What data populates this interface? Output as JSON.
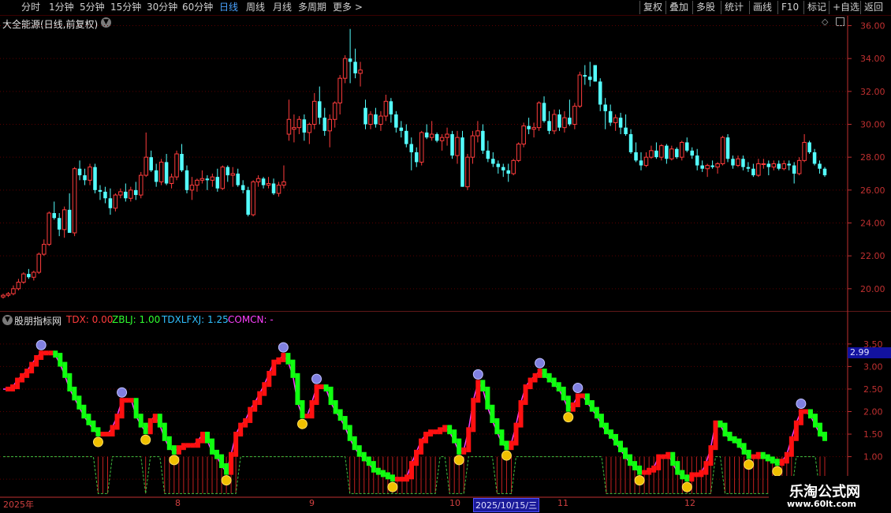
{
  "toolbar": {
    "left_items": [
      "分时",
      "1分钟",
      "5分钟",
      "15分钟",
      "30分钟",
      "60分钟",
      "日线",
      "周线",
      "月线",
      "多周期",
      "更多 >"
    ],
    "active_item": "日线",
    "right_items": [
      "复权",
      "叠加",
      "多股",
      "统计",
      "画线",
      "F10",
      "标记",
      "+自选",
      "返回"
    ]
  },
  "stock": {
    "title": "大全能源(日线,前复权)"
  },
  "price_axis": {
    "labels": [
      "36.00",
      "34.00",
      "32.00",
      "30.00",
      "28.00",
      "26.00",
      "24.00",
      "22.00",
      "20.00"
    ],
    "ymin": 18.6,
    "ymax": 36.6
  },
  "indicator": {
    "name": "股朋指标网",
    "tdx": "TDX: 0.00",
    "zblj": "ZBLJ: 1.00",
    "tdxlfxj": "TDXLFXJ: 1.25",
    "comcn": "COMCN: -",
    "axis_labels": [
      "3.50",
      "3.00",
      "2.50",
      "2.00",
      "1.50",
      "1.00",
      "0.50"
    ],
    "current_value": "2.99",
    "ymin": 0.1,
    "ymax": 3.9
  },
  "dates": {
    "labels": [
      "2025年",
      "8",
      "9",
      "10",
      "2025/10/15/三",
      "11",
      "12"
    ],
    "highlight": "2025/10/15/三"
  },
  "watermark": {
    "line1": "乐淘公式网",
    "line2": "www.60lt.com"
  },
  "colors": {
    "up": "#ff3c3c",
    "down": "#54ffff",
    "grid": "#5a0000",
    "axis": "#c03030",
    "ind_up": "#ff1010",
    "ind_down": "#10ff10",
    "ind_line": "#ff40ff",
    "ind_dash": "#40c040"
  },
  "chart_data": {
    "type": "candlestick",
    "candles": [
      [
        19.5,
        19.7,
        19.4,
        19.6
      ],
      [
        19.6,
        19.8,
        19.5,
        19.7
      ],
      [
        19.7,
        20.2,
        19.6,
        20.0
      ],
      [
        20.0,
        20.6,
        19.9,
        20.4
      ],
      [
        20.4,
        21.0,
        20.3,
        20.9
      ],
      [
        20.9,
        21.2,
        20.6,
        20.7
      ],
      [
        20.7,
        21.1,
        20.5,
        21.0
      ],
      [
        21.0,
        22.2,
        20.9,
        22.1
      ],
      [
        22.1,
        23.0,
        22.0,
        22.7
      ],
      [
        22.7,
        24.7,
        22.6,
        24.6
      ],
      [
        24.6,
        25.3,
        24.2,
        24.3
      ],
      [
        24.3,
        24.6,
        23.2,
        23.6
      ],
      [
        23.6,
        25.0,
        23.1,
        24.8
      ],
      [
        24.8,
        25.8,
        23.4,
        23.4
      ],
      [
        23.4,
        27.4,
        23.2,
        27.3
      ],
      [
        27.3,
        27.8,
        26.6,
        26.9
      ],
      [
        26.9,
        27.3,
        26.3,
        26.6
      ],
      [
        26.6,
        27.6,
        26.3,
        27.4
      ],
      [
        27.4,
        27.6,
        25.8,
        26.0
      ],
      [
        26.0,
        26.3,
        25.4,
        25.9
      ],
      [
        25.9,
        26.2,
        25.2,
        25.5
      ],
      [
        25.5,
        26.1,
        24.5,
        24.9
      ],
      [
        24.9,
        25.8,
        24.7,
        25.7
      ],
      [
        25.7,
        26.1,
        25.5,
        25.9
      ],
      [
        25.9,
        26.4,
        25.3,
        25.5
      ],
      [
        25.5,
        26.2,
        25.3,
        26.0
      ],
      [
        26.0,
        26.5,
        25.4,
        25.7
      ],
      [
        25.7,
        27.1,
        25.5,
        26.9
      ],
      [
        26.9,
        29.5,
        26.8,
        28.0
      ],
      [
        28.0,
        28.4,
        27.1,
        27.2
      ],
      [
        27.2,
        27.6,
        26.2,
        26.5
      ],
      [
        26.5,
        27.9,
        26.3,
        27.7
      ],
      [
        27.7,
        28.2,
        26.3,
        26.4
      ],
      [
        26.4,
        27.0,
        26.1,
        26.8
      ],
      [
        26.8,
        28.4,
        26.6,
        28.2
      ],
      [
        28.2,
        28.8,
        27.1,
        27.2
      ],
      [
        27.2,
        27.5,
        25.8,
        26.0
      ],
      [
        26.0,
        26.8,
        25.4,
        26.3
      ],
      [
        26.3,
        26.7,
        25.9,
        26.6
      ],
      [
        26.6,
        27.2,
        26.4,
        26.7
      ],
      [
        26.7,
        26.9,
        26.0,
        26.6
      ],
      [
        26.6,
        27.0,
        26.2,
        26.8
      ],
      [
        26.8,
        27.3,
        25.9,
        26.1
      ],
      [
        26.1,
        27.5,
        26.0,
        27.4
      ],
      [
        27.4,
        27.5,
        26.5,
        26.9
      ],
      [
        26.9,
        27.4,
        26.2,
        27.0
      ],
      [
        27.0,
        27.3,
        26.2,
        26.3
      ],
      [
        26.3,
        26.6,
        25.8,
        26.0
      ],
      [
        26.0,
        26.2,
        24.4,
        24.5
      ],
      [
        24.5,
        26.6,
        24.4,
        26.5
      ],
      [
        26.5,
        26.9,
        26.2,
        26.7
      ],
      [
        26.7,
        26.8,
        26.1,
        26.3
      ],
      [
        26.3,
        26.8,
        26.1,
        26.4
      ],
      [
        26.4,
        26.7,
        25.7,
        25.8
      ],
      [
        25.8,
        26.5,
        25.6,
        26.3
      ],
      [
        26.3,
        27.5,
        26.1,
        26.5
      ],
      [
        29.4,
        31.5,
        29.0,
        30.3
      ],
      [
        29.7,
        30.6,
        28.9,
        29.8
      ],
      [
        29.8,
        30.5,
        29.4,
        30.3
      ],
      [
        30.3,
        30.6,
        29.0,
        29.5
      ],
      [
        29.5,
        30.1,
        28.8,
        30.0
      ],
      [
        30.0,
        31.9,
        29.7,
        31.4
      ],
      [
        31.4,
        32.3,
        30.0,
        30.4
      ],
      [
        30.4,
        31.0,
        29.3,
        29.6
      ],
      [
        29.6,
        30.6,
        28.6,
        30.3
      ],
      [
        30.3,
        31.4,
        29.8,
        31.3
      ],
      [
        31.3,
        33.0,
        30.6,
        32.8
      ],
      [
        32.8,
        34.2,
        32.5,
        34.0
      ],
      [
        34.0,
        35.8,
        32.5,
        33.8
      ],
      [
        33.8,
        34.6,
        32.8,
        33.1
      ],
      [
        33.1,
        33.8,
        32.3,
        33.3
      ],
      [
        31.0,
        31.5,
        29.7,
        30.0
      ],
      [
        30.0,
        30.8,
        29.7,
        30.6
      ],
      [
        30.6,
        31.0,
        29.8,
        30.0
      ],
      [
        30.0,
        30.8,
        29.6,
        30.5
      ],
      [
        30.5,
        31.8,
        30.2,
        31.4
      ],
      [
        31.4,
        31.6,
        30.1,
        30.6
      ],
      [
        30.6,
        30.8,
        29.5,
        29.8
      ],
      [
        29.8,
        30.2,
        29.2,
        29.6
      ],
      [
        29.6,
        30.0,
        28.6,
        28.8
      ],
      [
        28.8,
        29.2,
        27.2,
        28.3
      ],
      [
        28.3,
        28.6,
        27.4,
        27.7
      ],
      [
        27.7,
        29.6,
        27.5,
        29.5
      ],
      [
        29.5,
        30.0,
        29.1,
        29.2
      ],
      [
        29.2,
        30.2,
        29.0,
        29.4
      ],
      [
        29.4,
        29.5,
        28.9,
        29.0
      ],
      [
        29.0,
        29.4,
        28.4,
        29.2
      ],
      [
        29.2,
        29.8,
        28.7,
        29.4
      ],
      [
        29.4,
        29.6,
        27.9,
        28.1
      ],
      [
        28.1,
        29.6,
        27.6,
        29.2
      ],
      [
        29.2,
        29.6,
        26.2,
        26.2
      ],
      [
        26.2,
        28.2,
        26.0,
        28.0
      ],
      [
        28.0,
        29.6,
        27.6,
        29.3
      ],
      [
        29.3,
        30.2,
        28.9,
        29.6
      ],
      [
        29.6,
        30.0,
        28.2,
        28.4
      ],
      [
        28.4,
        29.0,
        27.7,
        27.9
      ],
      [
        27.9,
        28.3,
        27.4,
        27.6
      ],
      [
        27.6,
        27.8,
        27.0,
        27.4
      ],
      [
        27.4,
        27.6,
        26.8,
        27.2
      ],
      [
        27.2,
        27.6,
        26.5,
        27.0
      ],
      [
        27.0,
        27.9,
        26.9,
        27.8
      ],
      [
        27.8,
        28.9,
        27.7,
        28.8
      ],
      [
        28.8,
        30.1,
        28.6,
        29.9
      ],
      [
        29.9,
        30.4,
        29.4,
        29.7
      ],
      [
        29.7,
        30.1,
        29.2,
        29.8
      ],
      [
        29.8,
        31.4,
        29.6,
        31.3
      ],
      [
        31.3,
        31.7,
        30.1,
        30.2
      ],
      [
        30.2,
        30.8,
        29.4,
        29.6
      ],
      [
        29.6,
        30.9,
        29.4,
        30.6
      ],
      [
        30.6,
        30.9,
        29.6,
        29.8
      ],
      [
        29.8,
        30.8,
        29.5,
        30.4
      ],
      [
        30.4,
        31.5,
        29.9,
        30.0
      ],
      [
        30.0,
        31.3,
        29.7,
        31.1
      ],
      [
        31.1,
        33.2,
        31.0,
        33.0
      ],
      [
        33.0,
        33.6,
        32.4,
        32.9
      ],
      [
        32.9,
        33.8,
        32.3,
        32.7
      ],
      [
        33.6,
        33.6,
        32.6,
        32.6
      ],
      [
        32.6,
        32.8,
        30.8,
        31.2
      ],
      [
        31.2,
        31.6,
        29.7,
        30.8
      ],
      [
        30.8,
        31.2,
        29.9,
        30.1
      ],
      [
        30.1,
        30.6,
        29.6,
        30.4
      ],
      [
        30.4,
        30.7,
        29.4,
        29.8
      ],
      [
        29.8,
        30.6,
        29.3,
        29.4
      ],
      [
        29.4,
        29.7,
        28.2,
        28.3
      ],
      [
        28.3,
        28.9,
        27.7,
        27.8
      ],
      [
        27.8,
        28.3,
        27.2,
        27.5
      ],
      [
        27.5,
        28.3,
        27.4,
        28.0
      ],
      [
        28.0,
        28.7,
        27.9,
        28.4
      ],
      [
        28.4,
        28.9,
        27.9,
        28.0
      ],
      [
        28.0,
        28.8,
        27.8,
        28.7
      ],
      [
        28.7,
        28.8,
        27.6,
        27.9
      ],
      [
        27.9,
        28.7,
        27.8,
        28.5
      ],
      [
        28.5,
        28.6,
        27.9,
        28.0
      ],
      [
        28.0,
        29.0,
        27.8,
        28.9
      ],
      [
        28.9,
        29.2,
        28.3,
        28.4
      ],
      [
        28.4,
        28.6,
        27.9,
        28.1
      ],
      [
        28.1,
        28.5,
        27.2,
        27.5
      ],
      [
        27.5,
        27.8,
        27.1,
        27.3
      ],
      [
        27.3,
        27.6,
        26.8,
        27.5
      ],
      [
        27.5,
        27.8,
        27.3,
        27.4
      ],
      [
        27.4,
        27.7,
        27.0,
        27.6
      ],
      [
        27.6,
        29.3,
        27.5,
        29.2
      ],
      [
        29.2,
        29.4,
        27.7,
        27.9
      ],
      [
        27.9,
        28.1,
        27.3,
        27.5
      ],
      [
        27.5,
        28.1,
        27.4,
        27.9
      ],
      [
        27.9,
        28.1,
        27.2,
        27.4
      ],
      [
        27.4,
        27.7,
        27.1,
        27.3
      ],
      [
        27.3,
        27.6,
        26.8,
        26.9
      ],
      [
        26.9,
        27.9,
        26.8,
        27.6
      ],
      [
        27.6,
        27.9,
        27.3,
        27.6
      ],
      [
        27.6,
        27.8,
        26.9,
        27.4
      ],
      [
        27.4,
        27.8,
        27.2,
        27.6
      ],
      [
        27.6,
        27.8,
        27.2,
        27.3
      ],
      [
        27.3,
        27.8,
        27.2,
        27.6
      ],
      [
        27.6,
        27.8,
        27.2,
        27.5
      ],
      [
        27.5,
        27.7,
        26.4,
        27.0
      ],
      [
        27.0,
        28.0,
        26.9,
        27.8
      ],
      [
        27.8,
        29.4,
        27.7,
        28.9
      ],
      [
        28.9,
        29.0,
        28.2,
        28.3
      ],
      [
        28.3,
        28.5,
        27.5,
        27.6
      ],
      [
        27.6,
        27.8,
        27.0,
        27.3
      ],
      [
        27.3,
        27.4,
        26.8,
        26.9
      ]
    ],
    "indicator_series": [
      2.5,
      2.5,
      2.55,
      2.7,
      2.8,
      2.9,
      3.05,
      3.2,
      3.3,
      3.3,
      3.3,
      3.25,
      3.05,
      2.8,
      2.5,
      2.3,
      2.1,
      1.9,
      1.75,
      1.6,
      1.5,
      1.5,
      1.5,
      1.65,
      1.9,
      2.25,
      2.25,
      2.25,
      1.9,
      1.7,
      1.55,
      1.8,
      1.9,
      1.7,
      1.4,
      1.2,
      1.1,
      1.2,
      1.25,
      1.25,
      1.25,
      1.35,
      1.5,
      1.35,
      1.1,
      1.0,
      0.8,
      0.65,
      1.05,
      1.5,
      1.7,
      1.8,
      2.05,
      2.2,
      2.4,
      2.6,
      2.85,
      3.1,
      3.15,
      3.25,
      3.1,
      2.8,
      2.2,
      1.9,
      1.9,
      2.2,
      2.55,
      2.55,
      2.5,
      2.2,
      2.0,
      1.85,
      1.65,
      1.4,
      1.2,
      1.05,
      0.95,
      0.85,
      0.7,
      0.65,
      0.6,
      0.55,
      0.5,
      0.5,
      0.5,
      0.55,
      0.85,
      1.1,
      1.35,
      1.5,
      1.55,
      1.55,
      1.6,
      1.65,
      1.55,
      1.35,
      1.1,
      1.15,
      1.6,
      2.25,
      2.65,
      2.5,
      2.1,
      1.8,
      1.55,
      1.3,
      1.2,
      1.3,
      1.7,
      2.2,
      2.55,
      2.7,
      2.8,
      2.9,
      2.8,
      2.7,
      2.6,
      2.5,
      2.3,
      2.05,
      2.15,
      2.35,
      2.35,
      2.2,
      2.05,
      1.9,
      1.7,
      1.55,
      1.45,
      1.3,
      1.15,
      1.0,
      0.85,
      0.75,
      0.65,
      0.65,
      0.7,
      0.75,
      1.0,
      1.0,
      1.05,
      0.85,
      0.65,
      0.55,
      0.5,
      0.6,
      0.6,
      0.65,
      0.85,
      1.2,
      1.75,
      1.7,
      1.5,
      1.4,
      1.35,
      1.25,
      1.1,
      1.0,
      1.0,
      1.05,
      1.0,
      0.95,
      0.9,
      0.85,
      0.9,
      1.05,
      1.4,
      1.75,
      2.0,
      2.0,
      1.9,
      1.7,
      1.5,
      1.4
    ]
  }
}
